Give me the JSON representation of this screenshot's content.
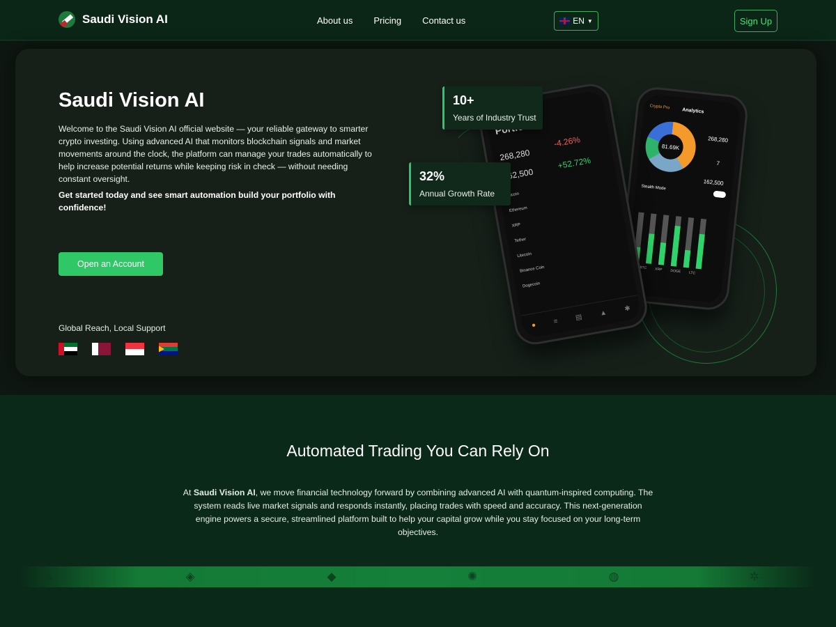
{
  "nav": {
    "brand": "Saudi Vision AI",
    "links": [
      "About us",
      "Pricing",
      "Contact us"
    ],
    "language": "EN",
    "signup": "Sign Up"
  },
  "hero": {
    "title": "Saudi Vision AI",
    "description": "Welcome to the Saudi Vision AI official website — your reliable gateway to smarter crypto investing. Using advanced AI that monitors blockchain signals and market movements around the clock, the platform can manage your trades automatically to help increase potential returns while keeping risk in check — without needing constant oversight.",
    "cta_text": "Get started today and see smart automation build your portfolio with confidence!",
    "button": "Open an Account",
    "reach_label": "Global Reach, Local Support",
    "flags": [
      "uae-flag",
      "qatar-flag",
      "singapore-flag",
      "south-africa-flag"
    ],
    "stats": [
      {
        "value": "10+",
        "label": "Years of Industry Trust"
      },
      {
        "value": "32%",
        "label": "Annual Growth Rate"
      }
    ]
  },
  "phone_left": {
    "heading": "Portfolio",
    "value": "268,280",
    "cost": "162,500",
    "gain1": "-4.26%",
    "gain2": "+52.72%",
    "coins": [
      "Bitcoin",
      "Ethereum",
      "XRP",
      "Tether",
      "Litecoin",
      "Binance Coin",
      "Dogecoin"
    ]
  },
  "phone_right": {
    "back": "Crypto Pro",
    "heading": "Analytics",
    "donut_value": "81.69K",
    "value": "268,280",
    "count": "7",
    "cost": "162,500",
    "toggle_label": "Stealth Mode",
    "bars": [
      "BTC",
      "XRP",
      "DOGE",
      "LTC"
    ],
    "bar_levels": [
      0.3,
      0.6,
      0.45,
      0.8,
      0.35,
      0.7
    ]
  },
  "section": {
    "title": "Automated Trading You Can Rely On",
    "text_prefix": "At ",
    "text_brand": "Saudi Vision AI",
    "text_body": ", we move financial technology forward by combining advanced AI with quantum-inspired computing. The system reads live market signals and responds instantly, placing trades with speed and accuracy. This next-generation engine powers a secure, streamlined platform built to help your capital grow while you stay focused on your long-term objectives."
  },
  "strip_icons": [
    "avalanche-icon",
    "binance-icon",
    "ethereum-icon",
    "polkadot-icon",
    "stellar-icon",
    "cosmos-icon"
  ],
  "colors": {
    "accent": "#30c867",
    "background": "#0a2918"
  }
}
